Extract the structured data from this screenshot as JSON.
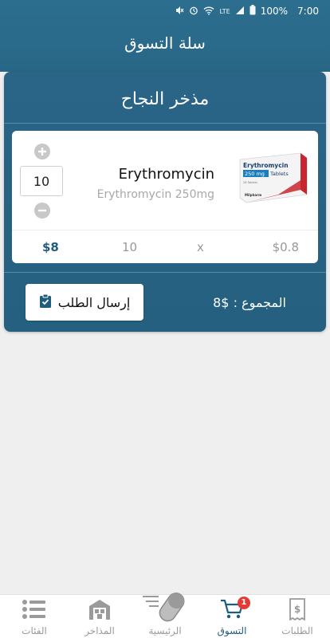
{
  "status_bar": {
    "signal": "LTE",
    "battery": "100%",
    "time": "7:00"
  },
  "header": {
    "title": "سلة التسوق"
  },
  "store": {
    "name": "مذخر النجاح"
  },
  "cart_item": {
    "quantity": "10",
    "product_name": "Erythromycin",
    "product_description": "Erythromycin 250mg",
    "total_price": "$8",
    "row_quantity": "10",
    "multiply_sign": "x",
    "unit_price": "$0.8",
    "package": {
      "brand": "Erythromycin",
      "dose": "250 mg",
      "form": "Tablets",
      "count": "28 Tablets",
      "maker": "Milpharm"
    }
  },
  "actions": {
    "submit_label": "إرسال الطلب",
    "total_text": "المجموع : $8"
  },
  "bottom_nav": {
    "items": [
      {
        "label": "الطلبات",
        "icon": "receipt-icon"
      },
      {
        "label": "التسوق",
        "icon": "cart-icon",
        "badge": "1",
        "active": true
      },
      {
        "label": "الرئيسية",
        "icon": "pill-icon"
      },
      {
        "label": "المذاخر",
        "icon": "warehouse-icon"
      },
      {
        "label": "الفئات",
        "icon": "list-icon"
      }
    ]
  },
  "colors": {
    "primary": "#2a6587",
    "accent_text": "#1f5c7e",
    "badge": "#e53935"
  }
}
